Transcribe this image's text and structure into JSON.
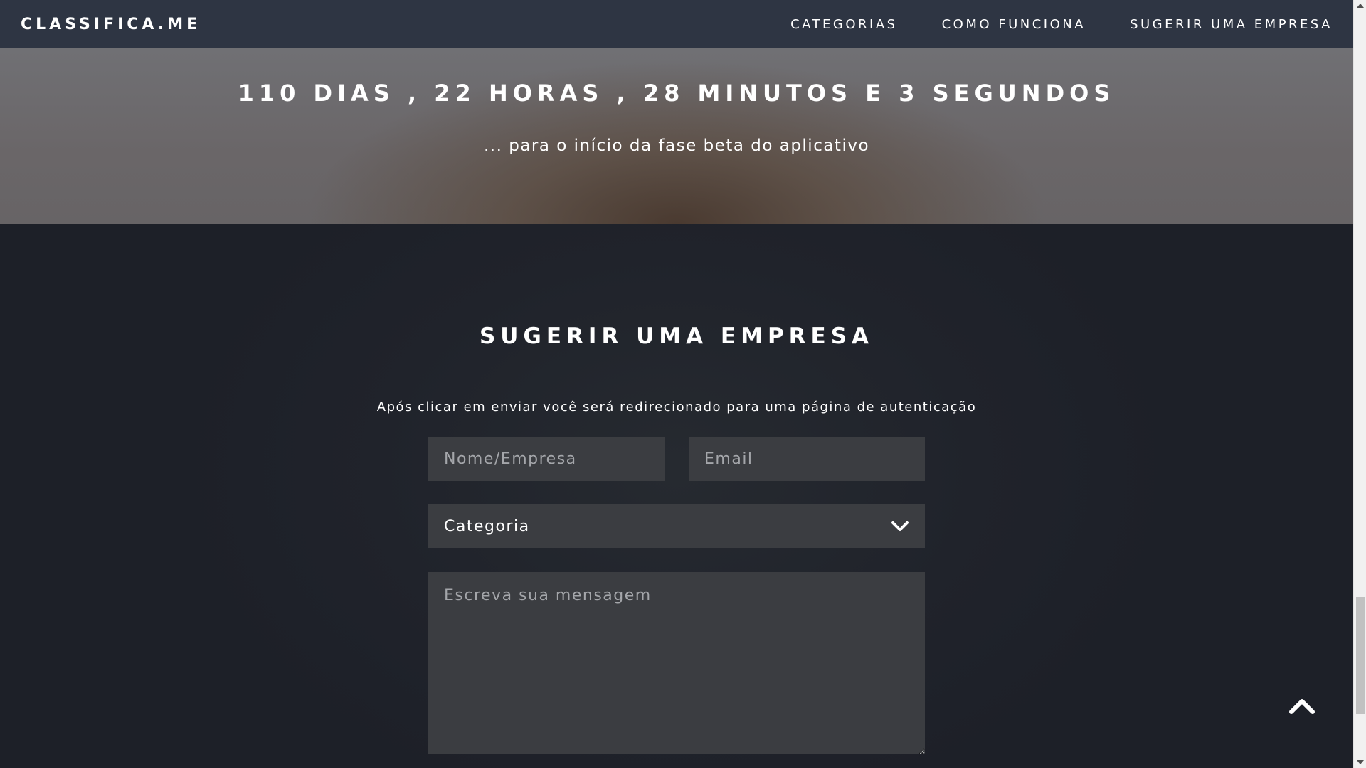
{
  "navbar": {
    "brand": "CLASSIFICA.ME",
    "links": [
      "CATEGORIAS",
      "COMO FUNCIONA",
      "SUGERIR UMA EMPRESA"
    ]
  },
  "banner": {
    "countdown": "110 DIAS , 22 HORAS , 28 MINUTOS E 3 SEGUNDOS",
    "subtitle": "... para o início da fase beta do aplicativo"
  },
  "suggest": {
    "title": "SUGERIR UMA EMPRESA",
    "note": "Após clicar em enviar você será redirecionado para uma página de autenticação",
    "name_placeholder": "Nome/Empresa",
    "email_placeholder": "Email",
    "category_value": "Categoria",
    "message_placeholder": "Escreva sua mensagem"
  },
  "icons": {
    "select_arrow": "chevron-down-icon",
    "scroll_top": "chevron-up-icon"
  },
  "colors": {
    "navbar_bg": "#2e3543",
    "section_bg": "#20232b",
    "field_bg": "#3b3d41",
    "text": "#ffffff"
  }
}
